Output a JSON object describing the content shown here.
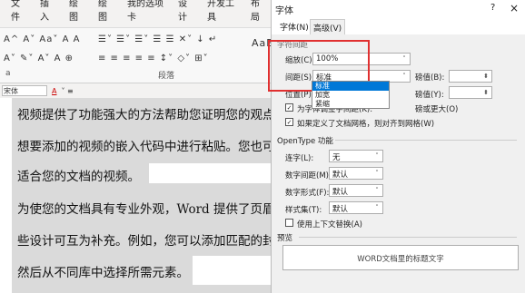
{
  "menu": [
    "文件",
    "插入",
    "绘图",
    "绘图",
    "我的选项卡",
    "设计",
    "开发工具",
    "布局"
  ],
  "ribbon": {
    "row1": "A^ A˅ Aa˅ A A",
    "row1b": "☰˅ ☰˅ ☰˅ ☰ ☰ ✕˅ ↓ ↵",
    "row2": "A˅ ✎˅ A˅ A ⊕",
    "row2b": "≡ ≡ ≡ ≡ ≡ ↕˅ ◇˅ ⊞˅",
    "group_font": "a",
    "group_para": "段落",
    "style_preview": "AaB"
  },
  "fmtbar": {
    "font": "宋体",
    "color_letter": "A"
  },
  "doc_lines": [
    "视频提供了功能强大的方法帮助您证明您的观点",
    "想要添加的视频的嵌入代码中进行粘贴。您也可",
    "适合您的文档的视频。",
    "为使您的文档具有专业外观，Word 提供了页眉",
    "些设计可互为补充。例如，您可以添加匹配的封面",
    "然后从不同库中选择所需元素。"
  ],
  "dialog": {
    "title": "字体",
    "help": "?",
    "close": "×",
    "tabs": [
      "字体(N)",
      "高级(V)"
    ],
    "section_spacing": "字符间距",
    "scale_label": "缩放(C):",
    "scale_value": "100%",
    "spacing_label": "间距(S):",
    "spacing_value": "标准",
    "spacing_options": [
      "标准",
      "加宽",
      "紧缩"
    ],
    "position_label": "位置(P):",
    "pt1_label": "磅值(B):",
    "pt2_label": "磅值(Y):",
    "kerning_label": "为字体调整字间距(K):",
    "kerning_suffix": "磅或更大(O)",
    "grid_label": "如果定义了文档网格，则对齐到网格(W)",
    "section_opentype": "OpenType 功能",
    "lig_label": "连字(L):",
    "lig_value": "无",
    "numspace_label": "数字间距(M):",
    "numspace_value": "默认",
    "numform_label": "数字形式(F):",
    "numform_value": "默认",
    "styleset_label": "样式集(T):",
    "styleset_value": "默认",
    "context_label": "使用上下文替换(A)",
    "section_preview": "预览",
    "preview_text": "WORD文档里的标题文字"
  }
}
